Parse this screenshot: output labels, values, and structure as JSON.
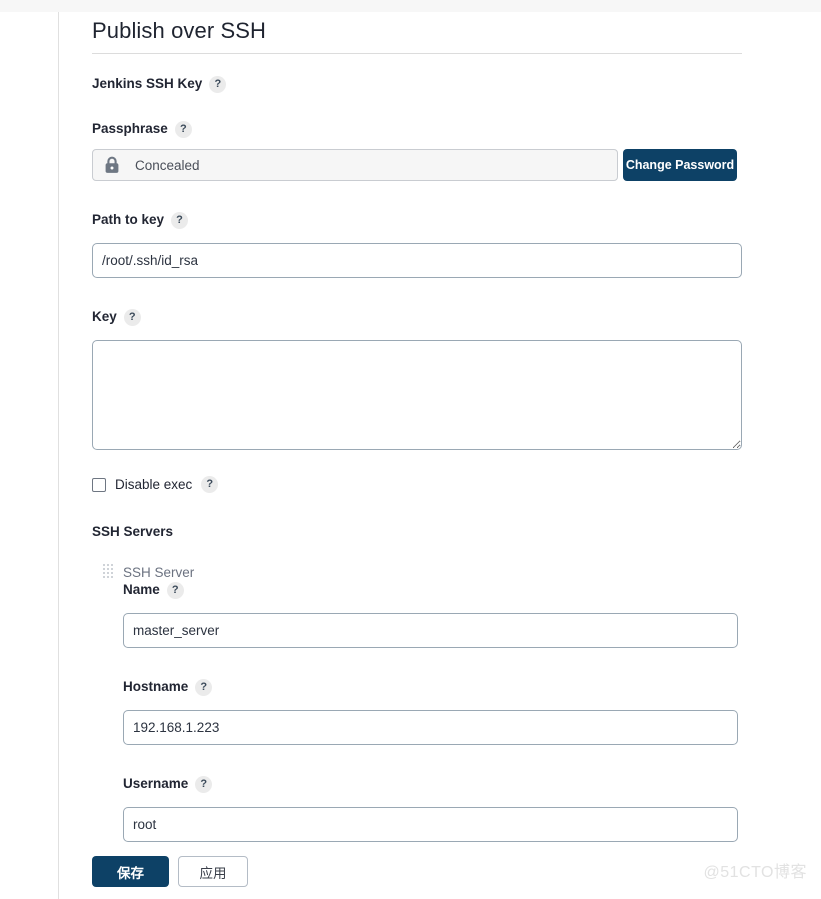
{
  "page": {
    "title": "Publish over SSH",
    "watermark": "@51CTO博客"
  },
  "fields": {
    "jenkins_ssh_key": {
      "label": "Jenkins SSH Key",
      "help": "?"
    },
    "passphrase": {
      "label": "Passphrase",
      "help": "?",
      "value": "Concealed",
      "icon": "lock-icon",
      "button_label": "Change Password"
    },
    "path_to_key": {
      "label": "Path to key",
      "help": "?",
      "value": "/root/.ssh/id_rsa"
    },
    "key": {
      "label": "Key",
      "help": "?",
      "value": ""
    },
    "disable_exec": {
      "label": "Disable exec",
      "help": "?",
      "checked": false
    }
  },
  "ssh_servers": {
    "section_label": "SSH Servers",
    "entries": [
      {
        "title": "SSH Server",
        "name": {
          "label": "Name",
          "help": "?",
          "value": "master_server"
        },
        "hostname": {
          "label": "Hostname",
          "help": "?",
          "value": "192.168.1.223"
        },
        "username": {
          "label": "Username",
          "help": "?",
          "value": "root"
        }
      }
    ]
  },
  "actions": {
    "save_label": "保存",
    "apply_label": "应用"
  },
  "colors": {
    "primary": "#0d4166",
    "input_border": "#9aa8b4",
    "help_bg": "#ebebeb"
  }
}
